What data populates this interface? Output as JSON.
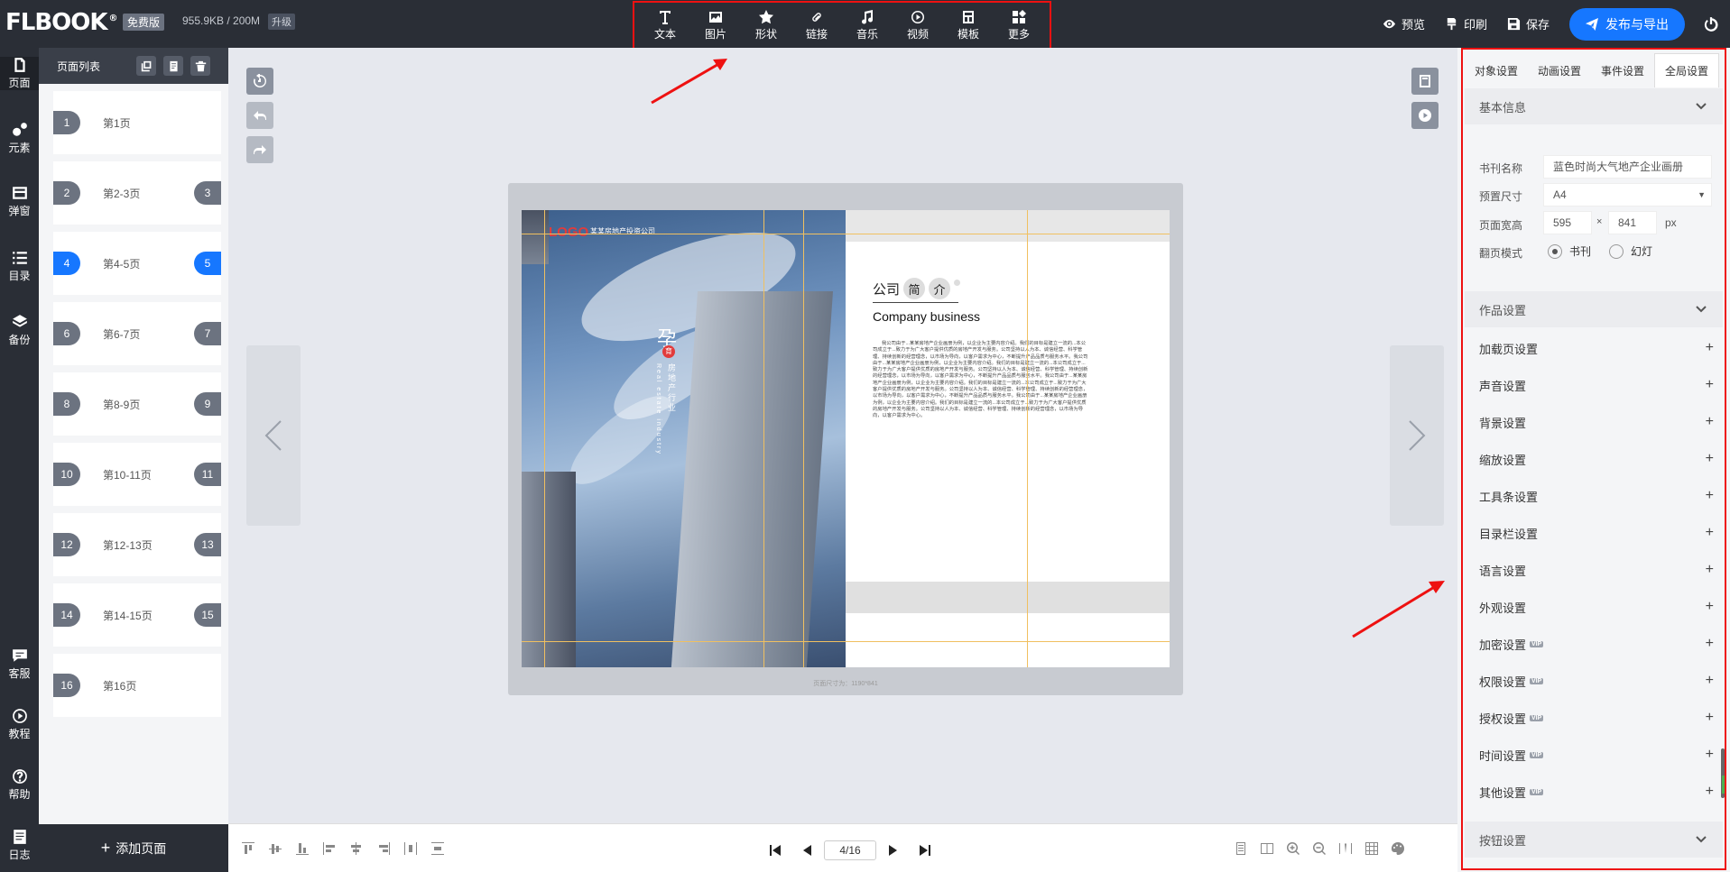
{
  "topbar": {
    "logo": "FLBOOK",
    "logo_mark": "®",
    "plan_badge": "免费版",
    "storage": "955.9KB / 200M",
    "upgrade": "升级",
    "tools": [
      {
        "label": "文本",
        "icon": "text-icon"
      },
      {
        "label": "图片",
        "icon": "image-icon"
      },
      {
        "label": "形状",
        "icon": "star-icon"
      },
      {
        "label": "链接",
        "icon": "link-icon"
      },
      {
        "label": "音乐",
        "icon": "music-icon"
      },
      {
        "label": "视频",
        "icon": "video-icon"
      },
      {
        "label": "模板",
        "icon": "template-icon"
      },
      {
        "label": "更多",
        "icon": "more-icon"
      }
    ],
    "preview": "预览",
    "print": "印刷",
    "save": "保存",
    "publish": "发布与导出"
  },
  "leftnav": {
    "items": [
      {
        "label": "页面",
        "icon": "page-icon"
      },
      {
        "label": "元素",
        "icon": "elements-icon"
      },
      {
        "label": "弹窗",
        "icon": "popup-icon"
      },
      {
        "label": "目录",
        "icon": "toc-icon"
      },
      {
        "label": "备份",
        "icon": "backup-icon"
      }
    ],
    "bottom": [
      {
        "label": "客服",
        "icon": "support-icon"
      },
      {
        "label": "教程",
        "icon": "tutorial-icon"
      },
      {
        "label": "帮助",
        "icon": "help-icon"
      },
      {
        "label": "日志",
        "icon": "log-icon"
      }
    ]
  },
  "pagelist": {
    "title": "页面列表",
    "items": [
      {
        "num": "1",
        "label": "第1页",
        "right": ""
      },
      {
        "num": "2",
        "label": "第2-3页",
        "right": "3"
      },
      {
        "num": "4",
        "label": "第4-5页",
        "right": "5",
        "active": true
      },
      {
        "num": "6",
        "label": "第6-7页",
        "right": "7"
      },
      {
        "num": "8",
        "label": "第8-9页",
        "right": "9"
      },
      {
        "num": "10",
        "label": "第10-11页",
        "right": "11"
      },
      {
        "num": "12",
        "label": "第12-13页",
        "right": "13"
      },
      {
        "num": "14",
        "label": "第14-15页",
        "right": "15"
      },
      {
        "num": "16",
        "label": "第16页",
        "right": ""
      }
    ],
    "add_page": "添加页面"
  },
  "book": {
    "left_logo": "LOGO",
    "left_company": "某某房地产投资公司",
    "vertical_char": "孕",
    "vertical_badge": "育",
    "vertical_text": "房地产行业",
    "vertical_sub": "Real estate industry",
    "title_word": "公司",
    "title_c1": "简",
    "title_c2": "介",
    "subtitle": "Company business",
    "body": "我公司由于...某某房地产企业画册为例，以企业为主要内容介绍。我们的目标是建立一流的...本公司成立于...致力于为广大客户提供优质的房地产开发与服务。公司坚持以人为本、诚信经营、科学管理、持续创新的经营理念，以市场为导向，以客户需求为中心，不断提升产品品质与服务水平。我公司由于...某某房地产企业画册为例，以企业为主要内容介绍。我们的目标是建立一流的...本公司成立于...致力于为广大客户提供优质的房地产开发与服务。公司坚持以人为本、诚信经营、科学管理、持续创新的经营理念，以市场为导向，以客户需求为中心，不断提升产品品质与服务水平。我公司由于...某某房地产企业画册为例，以企业为主要内容介绍。我们的目标是建立一流的...本公司成立于...致力于为广大客户提供优质的房地产开发与服务。公司坚持以人为本、诚信经营、科学管理、持续创新的经营理念，以市场为导向，以客户需求为中心，不断提升产品品质与服务水平。我公司由于...某某房地产企业画册为例，以企业为主要内容介绍。我们的目标是建立一流的...本公司成立于...致力于为广大客户提供优质的房地产开发与服务。公司坚持以人为本、诚信经营、科学管理、持续创新的经营理念，以市场为导向，以客户需求为中心。",
    "size_note": "页面尺寸为：1190*841"
  },
  "pager": {
    "current": "4/16"
  },
  "settings": {
    "tabs": [
      "对象设置",
      "动画设置",
      "事件设置",
      "全局设置"
    ],
    "basic_info": "基本信息",
    "book_name_label": "书刊名称",
    "book_name_value": "蓝色时尚大气地产企业画册",
    "preset_size_label": "预置尺寸",
    "preset_size_value": "A4",
    "page_size_label": "页面宽高",
    "width": "595",
    "times": "×",
    "height": "841",
    "unit": "px",
    "flip_mode_label": "翻页模式",
    "flip_book": "书刊",
    "flip_slide": "幻灯",
    "works_settings": "作品设置",
    "items": [
      {
        "label": "加载页设置",
        "vip": false
      },
      {
        "label": "声音设置",
        "vip": false
      },
      {
        "label": "背景设置",
        "vip": false
      },
      {
        "label": "缩放设置",
        "vip": false
      },
      {
        "label": "工具条设置",
        "vip": false
      },
      {
        "label": "目录栏设置",
        "vip": false
      },
      {
        "label": "语言设置",
        "vip": false
      },
      {
        "label": "外观设置",
        "vip": false
      },
      {
        "label": "加密设置",
        "vip": true
      },
      {
        "label": "权限设置",
        "vip": true
      },
      {
        "label": "授权设置",
        "vip": true
      },
      {
        "label": "时间设置",
        "vip": true
      },
      {
        "label": "其他设置",
        "vip": true
      }
    ],
    "vip_label": "VIP",
    "button_settings": "按钮设置"
  },
  "colors": {
    "accent": "#1677ff",
    "dark": "#2a2e36",
    "annotation": "#e11111"
  }
}
